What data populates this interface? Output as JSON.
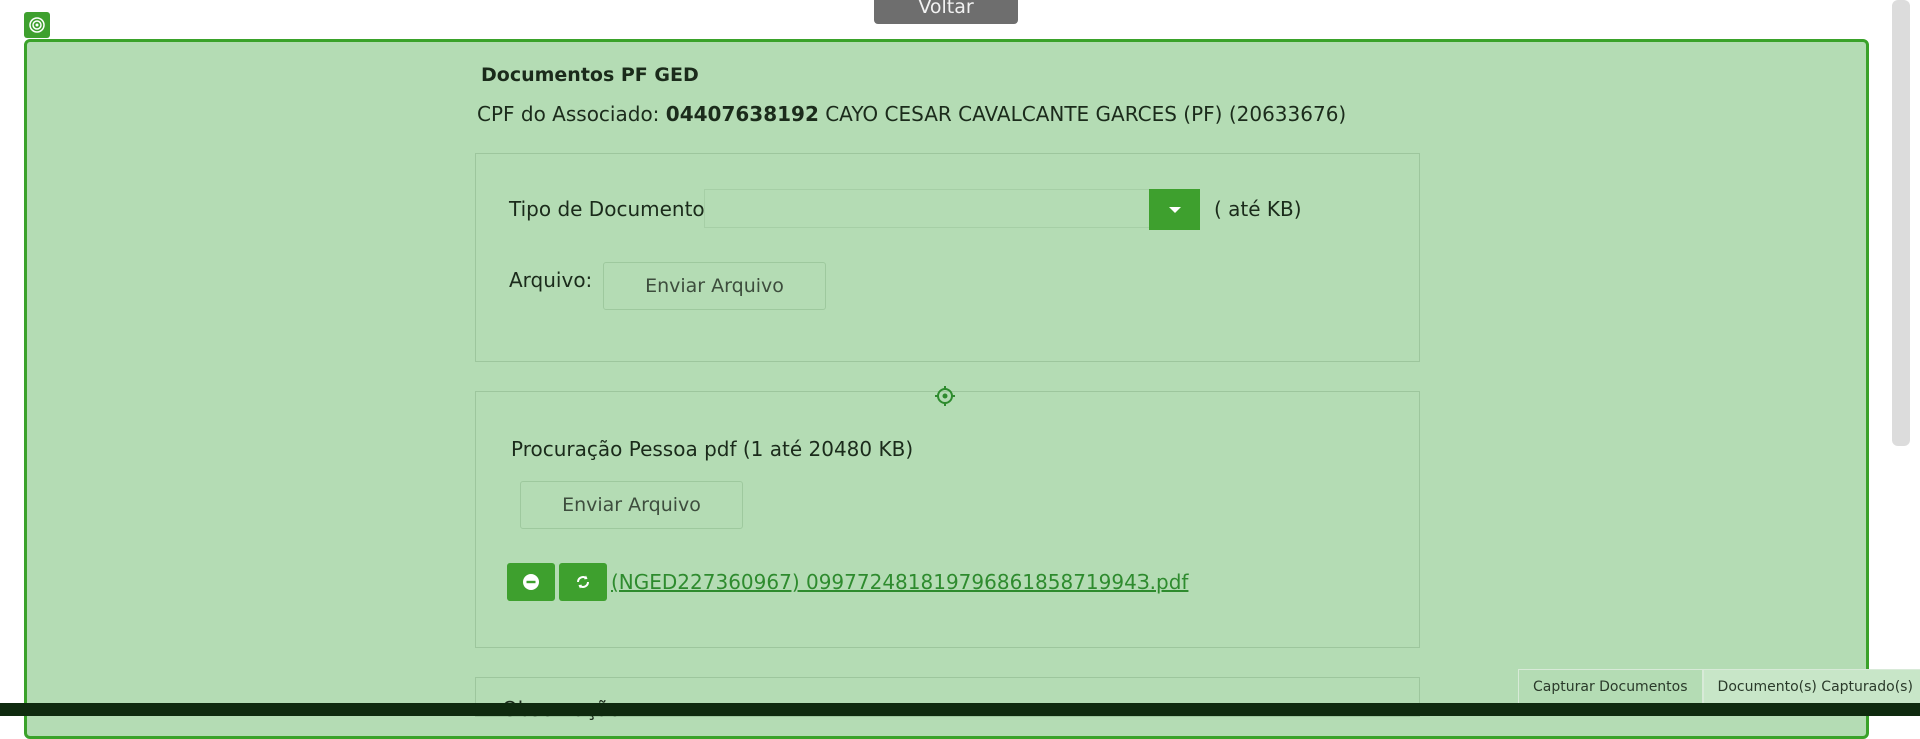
{
  "header": {
    "back_label": "Voltar"
  },
  "page": {
    "title": "Documentos PF GED",
    "cpf_label": "CPF do Associado:",
    "cpf_value": "04407638192",
    "associate_info": "CAYO CESAR CAVALCANTE GARCES (PF) (20633676)"
  },
  "upload_form": {
    "document_type_label": "Tipo de Documento:",
    "document_type_value": "",
    "size_hint": "( até KB)",
    "file_label": "Arquivo:",
    "send_button": "Enviar Arquivo"
  },
  "document_section": {
    "title": "Procuração Pessoa pdf (1 até 20480 KB)",
    "send_button": "Enviar Arquivo",
    "file_name": "(NGED227360967) 09977248181979686185871994З.pdf"
  },
  "observations": {
    "label": "Observação"
  },
  "tabs": [
    {
      "label": "Capturar Documentos"
    },
    {
      "label": "Documento(s) Capturado(s)"
    }
  ],
  "colors": {
    "panel_bg": "#b4dcb4",
    "accent": "#3ea02e",
    "link": "#2e8b2e"
  },
  "icons": {
    "corner": "target-icon",
    "select": "chevron-down-icon",
    "remove": "minus-circle-icon",
    "refresh": "refresh-icon",
    "drag": "crosshair-icon"
  }
}
